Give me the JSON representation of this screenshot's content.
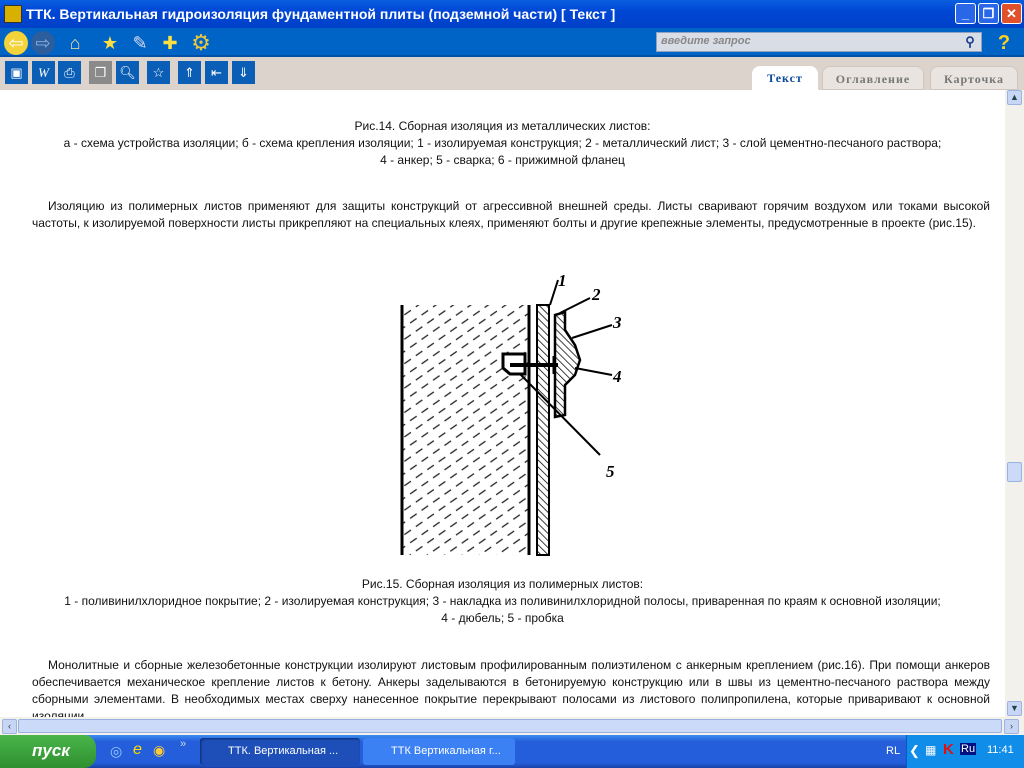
{
  "window": {
    "title": "ТТК. Вертикальная гидроизоляция фундаментной плиты (подземной части) [ Текст ]"
  },
  "search": {
    "placeholder": "введите запрос"
  },
  "tabs": [
    {
      "label": "Текст",
      "active": true
    },
    {
      "label": "Оглавление",
      "active": false
    },
    {
      "label": "Карточка",
      "active": false
    }
  ],
  "document": {
    "fig14_title": "Рис.14. Сборная изоляция из металлических листов:",
    "fig14_line1": "а - схема устройства изоляции; б - схема крепления изоляции; 1 - изолируемая конструкция; 2 - металлический лист; 3 - слой цементно-песчаного раствора;",
    "fig14_line2": "4 - анкер; 5 - сварка; 6 - прижимной фланец",
    "para1": "Изоляцию из полимерных листов применяют для защиты конструкций от агрессивной внешней среды. Листы сваривают горячим воздухом или токами высокой частоты, к изолируемой поверхности листы прикрепляют на специальных клеях, применяют болты и другие крепежные элементы, предусмотренные в проекте (рис.15).",
    "figure_labels": [
      "1",
      "2",
      "3",
      "4",
      "5"
    ],
    "fig15_title": "Рис.15. Сборная изоляция из полимерных листов:",
    "fig15_line1": "1 - поливинилхлоридное  покрытие; 2 - изолируемая конструкция; 3 - накладка из поливинилхлоридной полосы, приваренная по краям к основной изоляции;",
    "fig15_line2": "4 - дюбель; 5 - пробка",
    "para2": "Монолитные и сборные железобетонные конструкции изолируют листовым профилированным полиэтиленом с анкерным креплением (рис.16). При помощи анкеров обеспечивается механическое крепление листов к бетону. Анкеры заделываются в бетонируемую конструкцию или в швы из цементно-песчаного раствора между сборными элементами. В необходимых местах сверху нанесенное покрытие перекрывают полосами из листового полипропилена, которые приваривают к основной изоляции."
  },
  "taskbar": {
    "start_label": "пуск",
    "tasks": [
      {
        "label": "ТТК. Вертикальная ..."
      },
      {
        "label": "ТТК Вертикальная г..."
      }
    ],
    "lang_rl": "RL",
    "lang": "Ru",
    "clock": "11:41"
  }
}
